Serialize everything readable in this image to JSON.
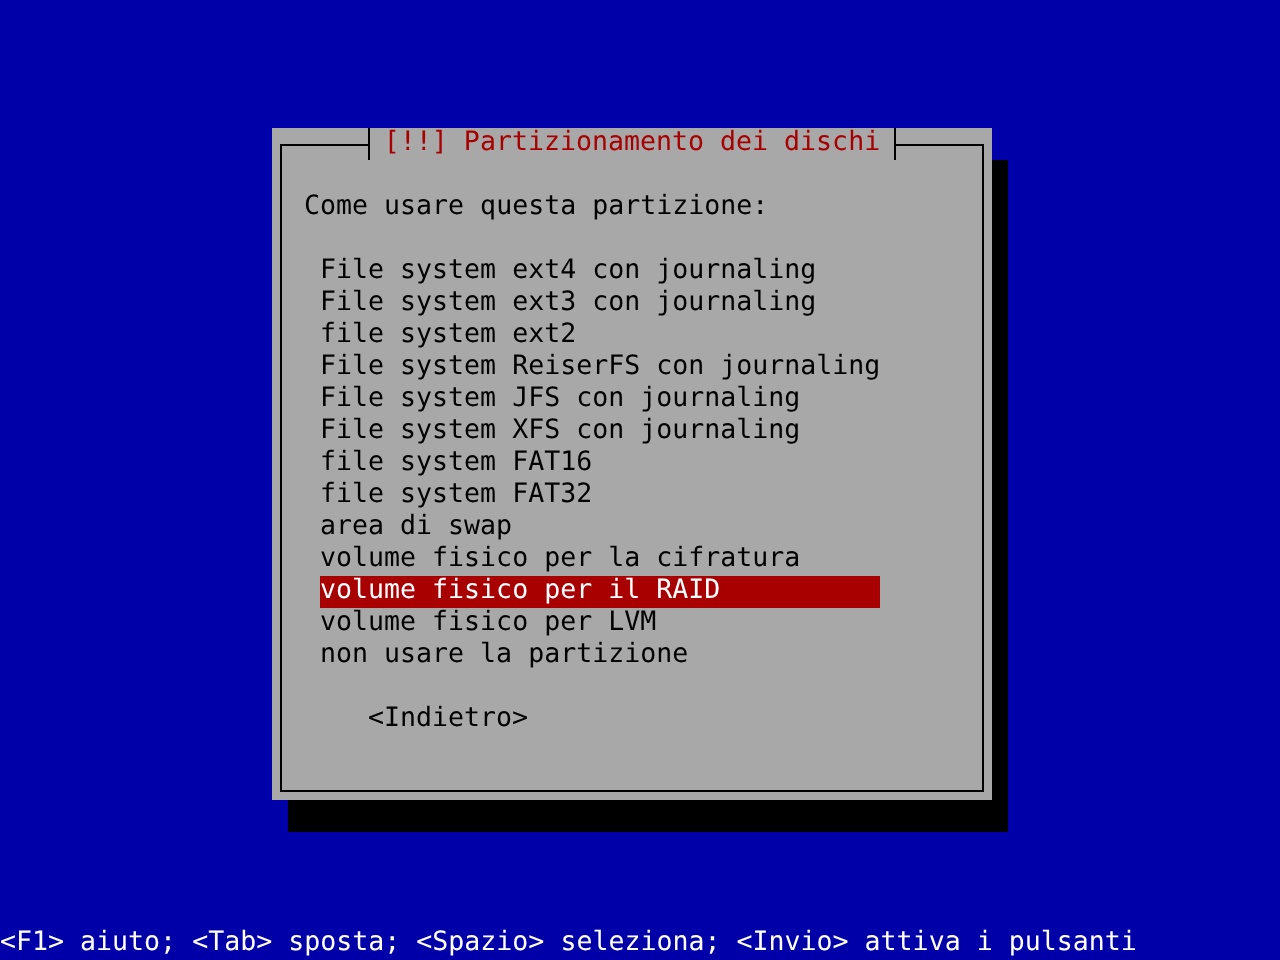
{
  "dialog": {
    "title": "[!!] Partizionamento dei dischi",
    "prompt": "Come usare questa partizione:",
    "options": [
      {
        "label": "File system ext4 con journaling",
        "selected": false
      },
      {
        "label": "File system ext3 con journaling",
        "selected": false
      },
      {
        "label": "file system ext2",
        "selected": false
      },
      {
        "label": "File system ReiserFS con journaling",
        "selected": false
      },
      {
        "label": "File system JFS con journaling",
        "selected": false
      },
      {
        "label": "File system XFS con journaling",
        "selected": false
      },
      {
        "label": "file system FAT16",
        "selected": false
      },
      {
        "label": "file system FAT32",
        "selected": false
      },
      {
        "label": "area di swap",
        "selected": false
      },
      {
        "label": "volume fisico per la cifratura",
        "selected": false
      },
      {
        "label": "volume fisico per il RAID",
        "selected": true
      },
      {
        "label": "volume fisico per LVM",
        "selected": false
      },
      {
        "label": "non usare la partizione",
        "selected": false
      }
    ],
    "back_button": "<Indietro>"
  },
  "status_bar": "<F1> aiuto; <Tab> sposta; <Spazio> seleziona; <Invio> attiva i pulsanti"
}
